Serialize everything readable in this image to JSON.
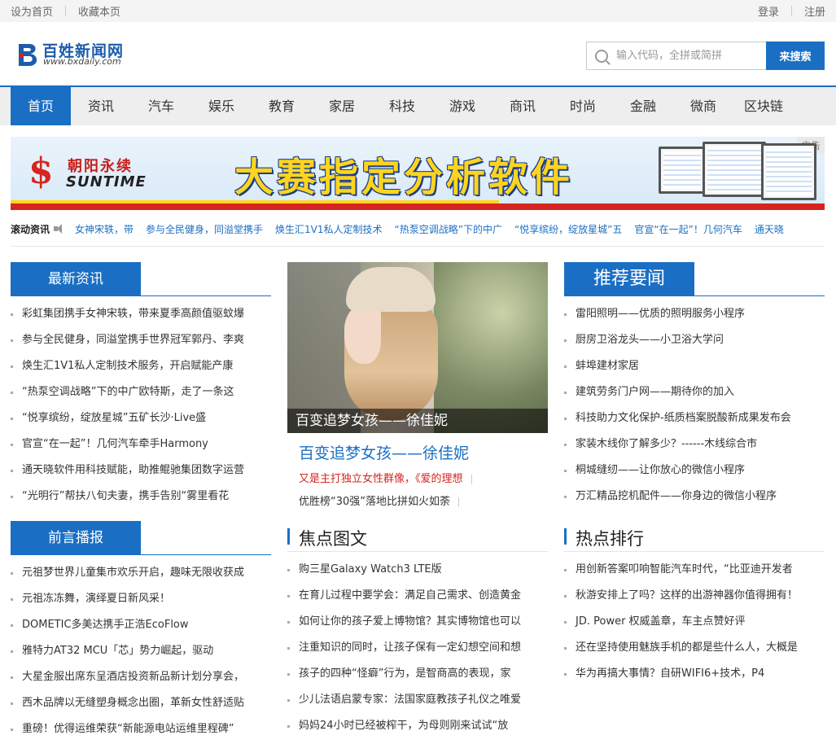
{
  "topbar": {
    "set_home": "设为首页",
    "bookmark": "收藏本页",
    "login": "登录",
    "register": "注册"
  },
  "logo": {
    "name": "百姓新闻网",
    "url": "www.bxdaily.com"
  },
  "search": {
    "placeholder": "输入代码，全拼或简拼",
    "button": "来搜索"
  },
  "nav": [
    "首页",
    "资讯",
    "汽车",
    "娱乐",
    "教育",
    "家居",
    "科技",
    "游戏",
    "商讯",
    "时尚",
    "金融",
    "微商",
    "区块链"
  ],
  "banner": {
    "brand_cn": "朝阳永续",
    "brand_en": "SUNTIME",
    "slogan": "大赛指定分析软件",
    "ad_tag": "广告"
  },
  "ticker": {
    "label": "滚动资讯",
    "items": [
      "女神宋轶，带",
      "参与全民健身，同溢堂携手",
      "焕生汇1V1私人定制技术",
      "“热泵空调战略”下的中广",
      "“悦享缤纷，绽放星城”五",
      "官宣“在一起”！几何汽车",
      "通天晓"
    ]
  },
  "latest": {
    "title": "最新资讯",
    "items": [
      "彩虹集团携手女神宋轶，带来夏季高颜值驱蚊爆",
      "参与全民健身，同溢堂携手世界冠军郭丹、李爽",
      "焕生汇1V1私人定制技术服务，开启赋能产康",
      "“热泵空调战略”下的中广欧特斯，走了一条这",
      "“悦享缤纷，绽放星城”五矿长沙·Live盛",
      "官宣“在一起”！几何汽车牵手Harmony",
      "通天晓软件用科技赋能，助推鲲驰集团数字运营",
      "“光明行”帮扶八旬夫妻，携手告别“雾里看花"
    ]
  },
  "preface": {
    "title": "前言播报",
    "items": [
      "元祖梦世界儿童集市欢乐开启，趣味无限收获成",
      "元祖冻冻舞，演绎夏日新风采！",
      "DOMETIC多美达携手正浩EcoFlow",
      "雅特力AT32 MCU「芯」势力崛起，驱动",
      "大星金服出席东呈酒店投资新品新计划分享会，",
      "西木品牌以无缝塑身概念出圈，革新女性舒适贴",
      "重磅！优得运维荣获“新能源电站运维里程碑”"
    ]
  },
  "feature": {
    "caption": "百变追梦女孩——徐佳妮",
    "title": "百变追梦女孩——徐佳妮",
    "sub_red": "又是主打独立女性群像，《爱的理想",
    "sub": "优胜榜“30强”落地比拼如火如荼"
  },
  "focus": {
    "title": "焦点图文",
    "items": [
      "购三星Galaxy Watch3 LTE版",
      "在育儿过程中要学会：满足自己需求、创造黄金",
      "如何让你的孩子爱上博物馆？其实博物馆也可以",
      "注重知识的同时，让孩子保有一定幻想空间和想",
      "孩子的四种“怪癖”行为，是智商高的表现，家",
      "少儿法语启蒙专家：法国家庭教孩子礼仪之唯爱",
      "妈妈24小时已经被榨干，为母则刚来试试“放"
    ]
  },
  "recommend": {
    "title": "推荐要闻",
    "items": [
      "雷阳照明——优质的照明服务小程序",
      "厨房卫浴龙头——小卫浴大学问",
      "蚌埠建材家居",
      "建筑劳务门户网——期待你的加入",
      "科技助力文化保护-纸质档案脱酸新成果发布会",
      "家装木线你了解多少？------木线综合市",
      "桐城缝纫——让你放心的微信小程序",
      "万汇精品挖机配件——你身边的微信小程序"
    ]
  },
  "hot": {
    "title": "热点排行",
    "items": [
      "用创新答案叩响智能汽车时代，“比亚迪开发者",
      "秋游安排上了吗？这样的出游神器你值得拥有！",
      "JD. Power 权威盖章，车主点赞好评",
      "还在坚持使用魅族手机的都是些什么人，大概是",
      "华为再搞大事情？自研WIFI6+技术，P4"
    ]
  },
  "colors": {
    "accent": "#1a6fc4",
    "red": "#d6241e"
  }
}
